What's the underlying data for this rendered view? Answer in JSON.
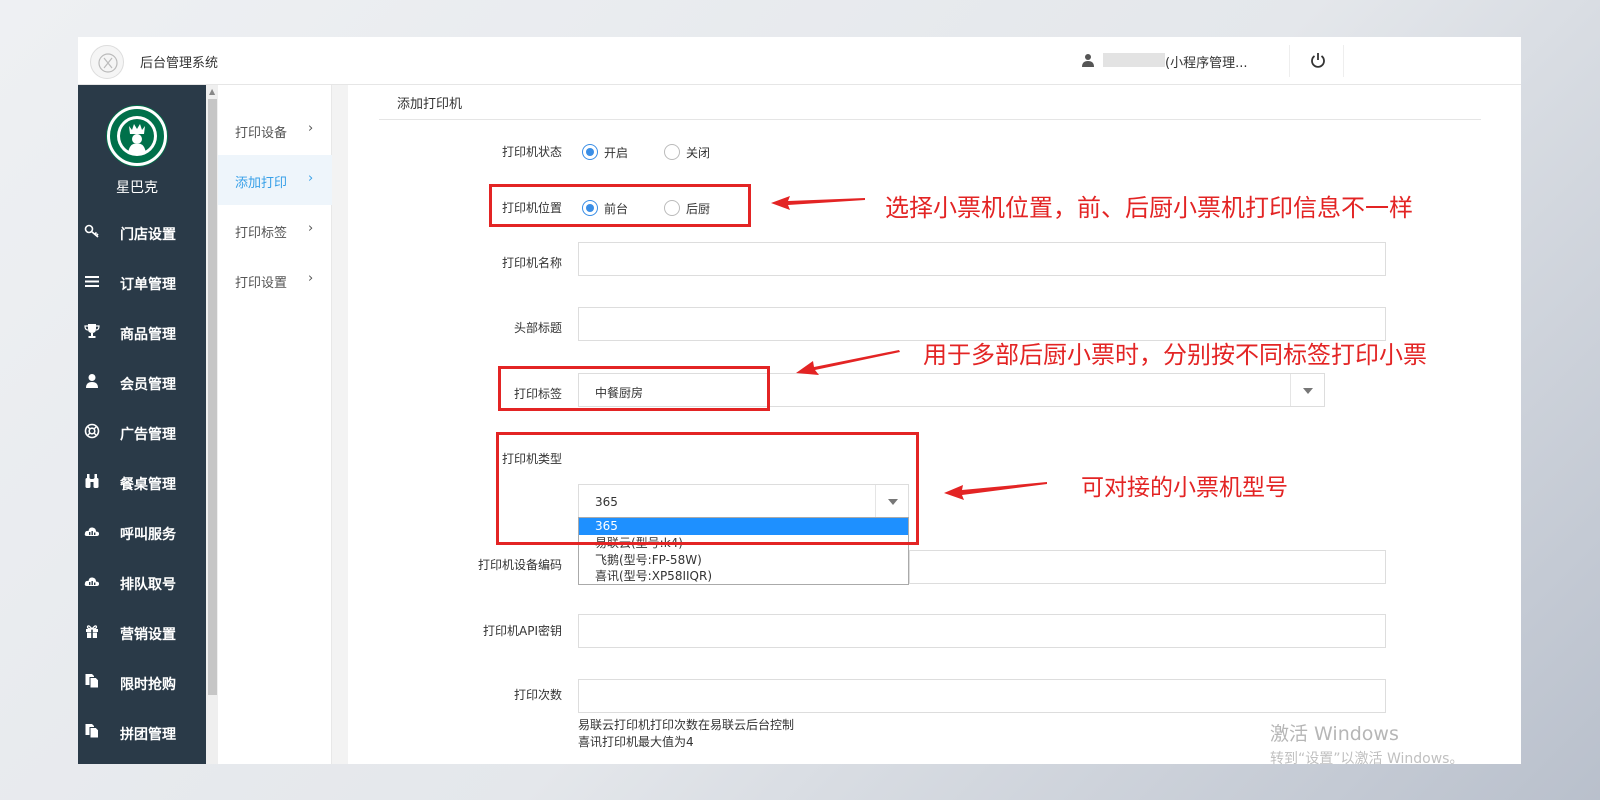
{
  "header": {
    "app_title": "后台管理系统",
    "user_name": "(小程序管理..."
  },
  "sidebar": {
    "brand_name": "星巴克",
    "items": [
      {
        "label": "门店设置",
        "icon": "key-icon"
      },
      {
        "label": "订单管理",
        "icon": "list-icon"
      },
      {
        "label": "商品管理",
        "icon": "trophy-icon"
      },
      {
        "label": "会员管理",
        "icon": "user-icon"
      },
      {
        "label": "广告管理",
        "icon": "lifebuoy-icon"
      },
      {
        "label": "餐桌管理",
        "icon": "binoculars-icon"
      },
      {
        "label": "呼叫服务",
        "icon": "cloud-icon"
      },
      {
        "label": "排队取号",
        "icon": "cloud-icon"
      },
      {
        "label": "营销设置",
        "icon": "gift-icon"
      },
      {
        "label": "限时抢购",
        "icon": "copy-icon"
      },
      {
        "label": "拼团管理",
        "icon": "copy-icon"
      }
    ]
  },
  "submenu": {
    "items": [
      {
        "label": "打印设备",
        "active": false
      },
      {
        "label": "添加打印",
        "active": true
      },
      {
        "label": "打印标签",
        "active": false
      },
      {
        "label": "打印设置",
        "active": false
      }
    ],
    "chevron": "›"
  },
  "content": {
    "title": "添加打印机",
    "form": {
      "status": {
        "label": "打印机状态",
        "options": [
          "开启",
          "关闭"
        ],
        "selected": "开启"
      },
      "position": {
        "label": "打印机位置",
        "options": [
          "前台",
          "后厨"
        ],
        "selected": "前台"
      },
      "name": {
        "label": "打印机名称",
        "value": ""
      },
      "header_title": {
        "label": "头部标题",
        "value": ""
      },
      "tag": {
        "label": "打印标签",
        "value": "中餐厨房"
      },
      "type": {
        "label": "打印机类型",
        "value": "365",
        "options": [
          "365",
          "易联云(型号:k4)",
          "飞鹅(型号:FP-58W)",
          "喜讯(型号:XP58IIQR)"
        ],
        "highlighted": "365"
      },
      "device_code": {
        "label": "打印机设备编码",
        "value": ""
      },
      "api_key": {
        "label": "打印机API密钥",
        "value": ""
      },
      "print_count": {
        "label": "打印次数",
        "value": "",
        "hints": [
          "易联云打印机打印次数在易联云后台控制",
          "喜讯打印机最大值为4"
        ]
      }
    }
  },
  "annotations": {
    "position_note": "选择小票机位置，前、后厨小票机打印信息不一样",
    "tag_note": "用于多部后厨小票时，分别按不同标签打印小票",
    "type_note": "可对接的小票机型号",
    "color": "#e32424"
  },
  "watermark": {
    "line1": "激活 Windows",
    "line2": "转到“设置”以激活 Windows。"
  },
  "colors": {
    "sidebar_bg": "#2a3a48",
    "accent": "#3a8ee6",
    "submenu_active": "#38a0e8"
  }
}
